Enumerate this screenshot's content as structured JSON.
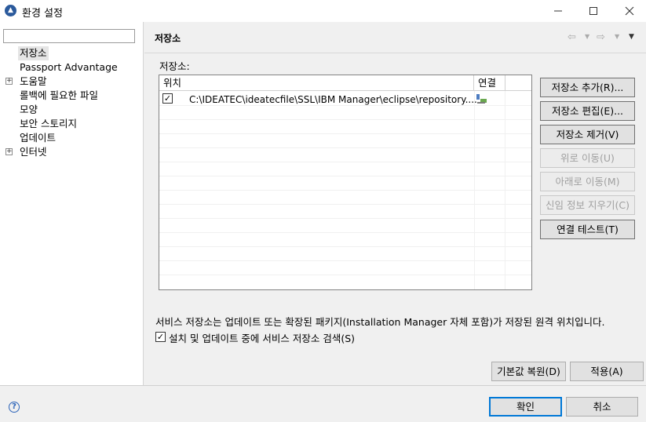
{
  "window": {
    "title": "환경 설정",
    "app_icon": "ibm-installation-manager-icon"
  },
  "sidebar": {
    "filter_value": "",
    "items": [
      {
        "label": "저장소",
        "expandable": false,
        "selected": true
      },
      {
        "label": "Passport Advantage",
        "expandable": false,
        "selected": false
      },
      {
        "label": "도움말",
        "expandable": true,
        "selected": false
      },
      {
        "label": "롤백에 필요한 파일",
        "expandable": false,
        "selected": false
      },
      {
        "label": "모양",
        "expandable": false,
        "selected": false
      },
      {
        "label": "보안 스토리지",
        "expandable": false,
        "selected": false
      },
      {
        "label": "업데이트",
        "expandable": false,
        "selected": false
      },
      {
        "label": "인터넷",
        "expandable": true,
        "selected": false
      }
    ]
  },
  "page": {
    "title": "저장소",
    "repo_list_label": "저장소:",
    "table": {
      "columns": [
        "위치",
        "연결"
      ],
      "rows": [
        {
          "checked": true,
          "path": "C:\\IDEATEC\\ideatecfile\\SSL\\IBM Manager\\eclipse\\repository....",
          "connection_icon": "connection-icon"
        }
      ]
    },
    "buttons": {
      "add": "저장소 추가(R)...",
      "edit": "저장소 편집(E)...",
      "remove": "저장소 제거(V)",
      "move_up": "위로 이동(U)",
      "move_down": "아래로 이동(M)",
      "clear_credentials": "신임 정보 지우기(C)",
      "test_connection": "연결 테스트(T)"
    },
    "description": "서비스 저장소는 업데이트 또는 확장된 패키지(Installation Manager 자체 포함)가 저장된 원격 위치입니다.",
    "search_checkbox": {
      "checked": true,
      "label": "설치 및 업데이트 중에 서비스 저장소 검색(S)"
    },
    "restore_defaults": "기본값 복원(D)",
    "apply": "적용(A)"
  },
  "footer": {
    "ok": "확인",
    "cancel": "취소"
  }
}
